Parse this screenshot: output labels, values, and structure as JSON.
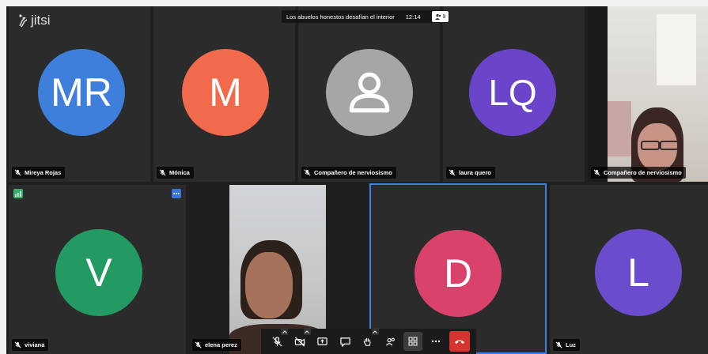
{
  "app": {
    "logo_text": "jitsi"
  },
  "meeting": {
    "title": "Los abuelos honestos desafían el interior",
    "time": "12:14",
    "participant_count": "9"
  },
  "colors": {
    "mr": "#3e7fdc",
    "m": "#f06a4b",
    "placeholder": "#a6a6a6",
    "lq": "#6b45c9",
    "v": "#239a61",
    "d": "#d9426a",
    "l": "#6b4ccd",
    "active_border": "#3c82e6",
    "hangup": "#d6352f"
  },
  "participants": [
    {
      "initials": "MR",
      "name": "Mireya Rojas"
    },
    {
      "initials": "M",
      "name": "Mónica"
    },
    {
      "initials": "",
      "name": "Compañero de nerviosismo"
    },
    {
      "initials": "LQ",
      "name": "laura quero"
    },
    {
      "initials": "",
      "name": "Compañero de nerviosismo"
    },
    {
      "initials": "V",
      "name": "viviana"
    },
    {
      "initials": "",
      "name": "elena perez"
    },
    {
      "initials": "D",
      "name": ""
    },
    {
      "initials": "L",
      "name": "Luz"
    }
  ],
  "toolbar": {
    "buttons": [
      "microphone-icon",
      "camera-icon",
      "screen-share-icon",
      "chat-icon",
      "raise-hand-icon",
      "participants-icon",
      "tile-view-icon",
      "more-icon",
      "hangup-icon"
    ]
  }
}
